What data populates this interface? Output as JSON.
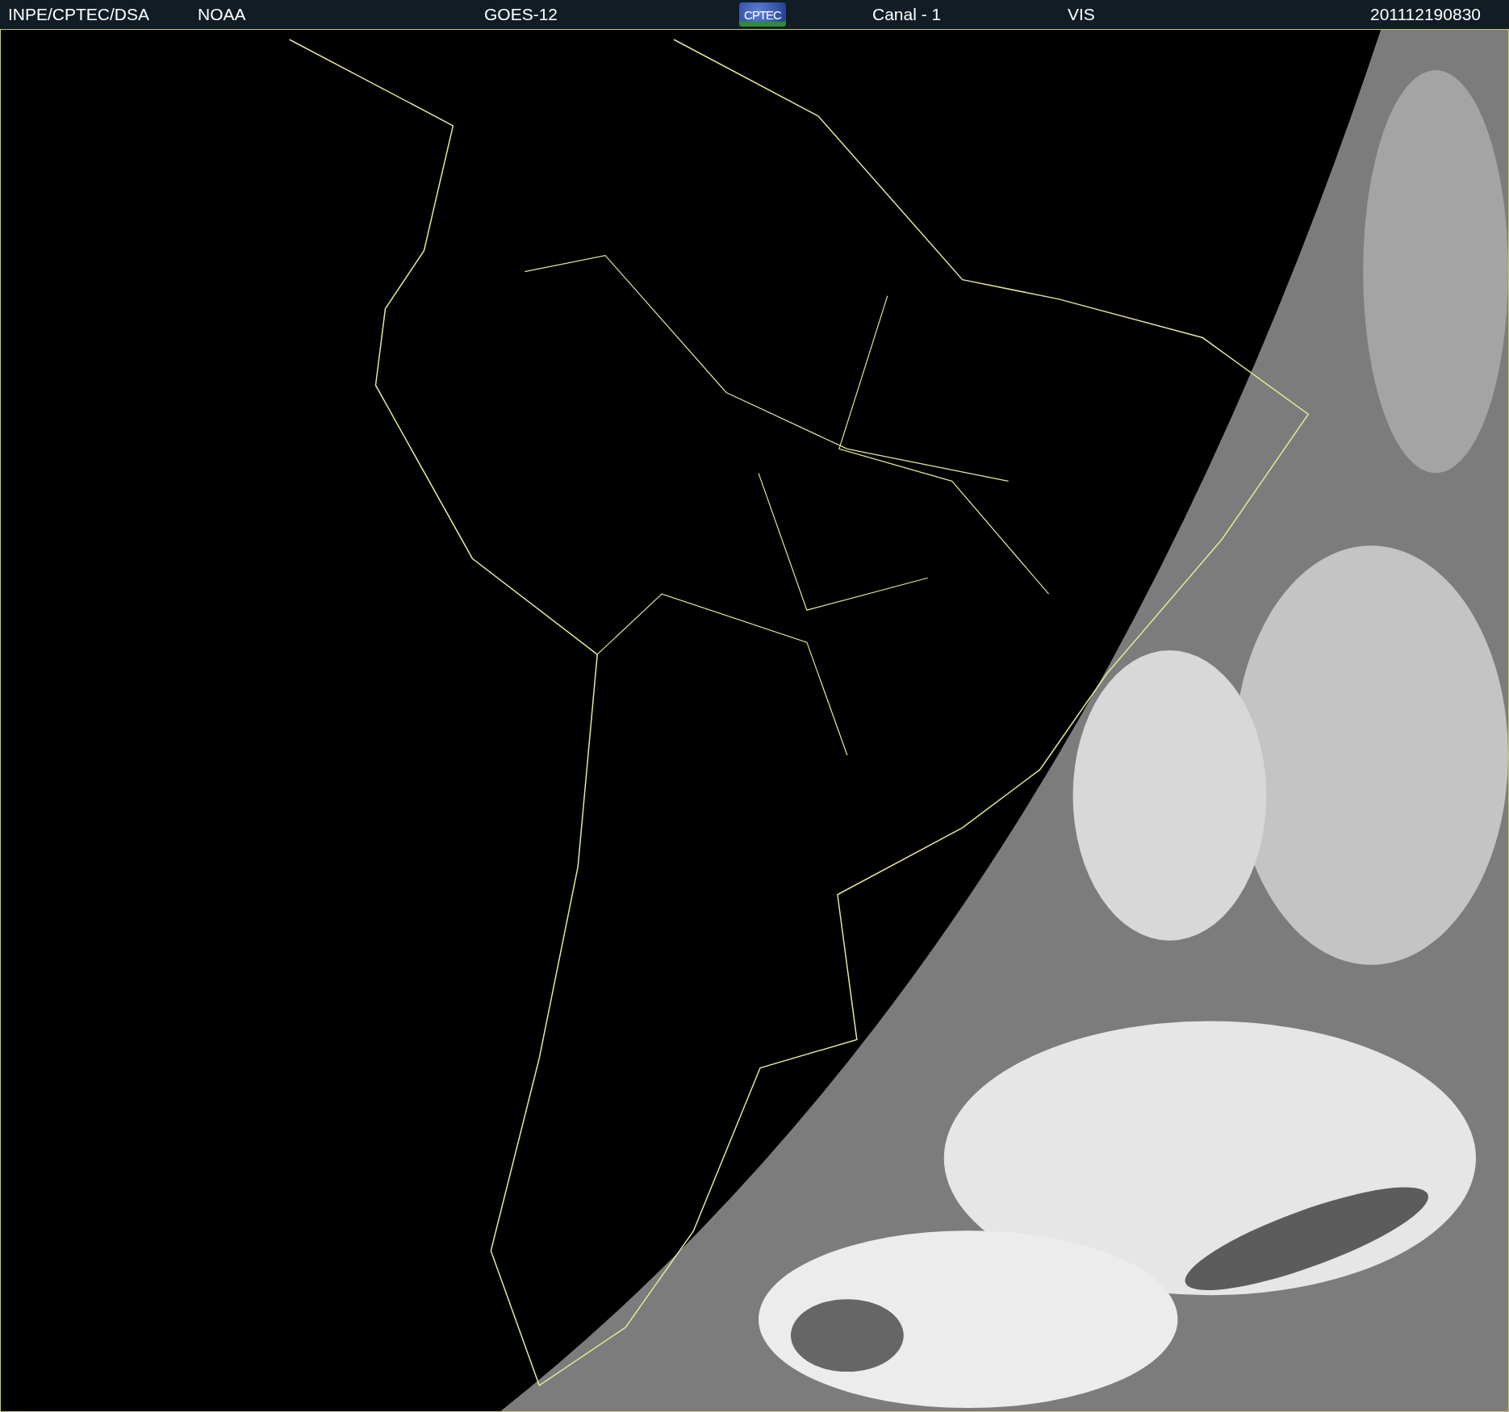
{
  "header": {
    "source": "INPE/CPTEC/DSA",
    "agency": "NOAA",
    "satellite": "GOES-12",
    "logo": "CPTEC",
    "channel": "Canal - 1",
    "band": "VIS",
    "timestamp": "201112190830"
  }
}
